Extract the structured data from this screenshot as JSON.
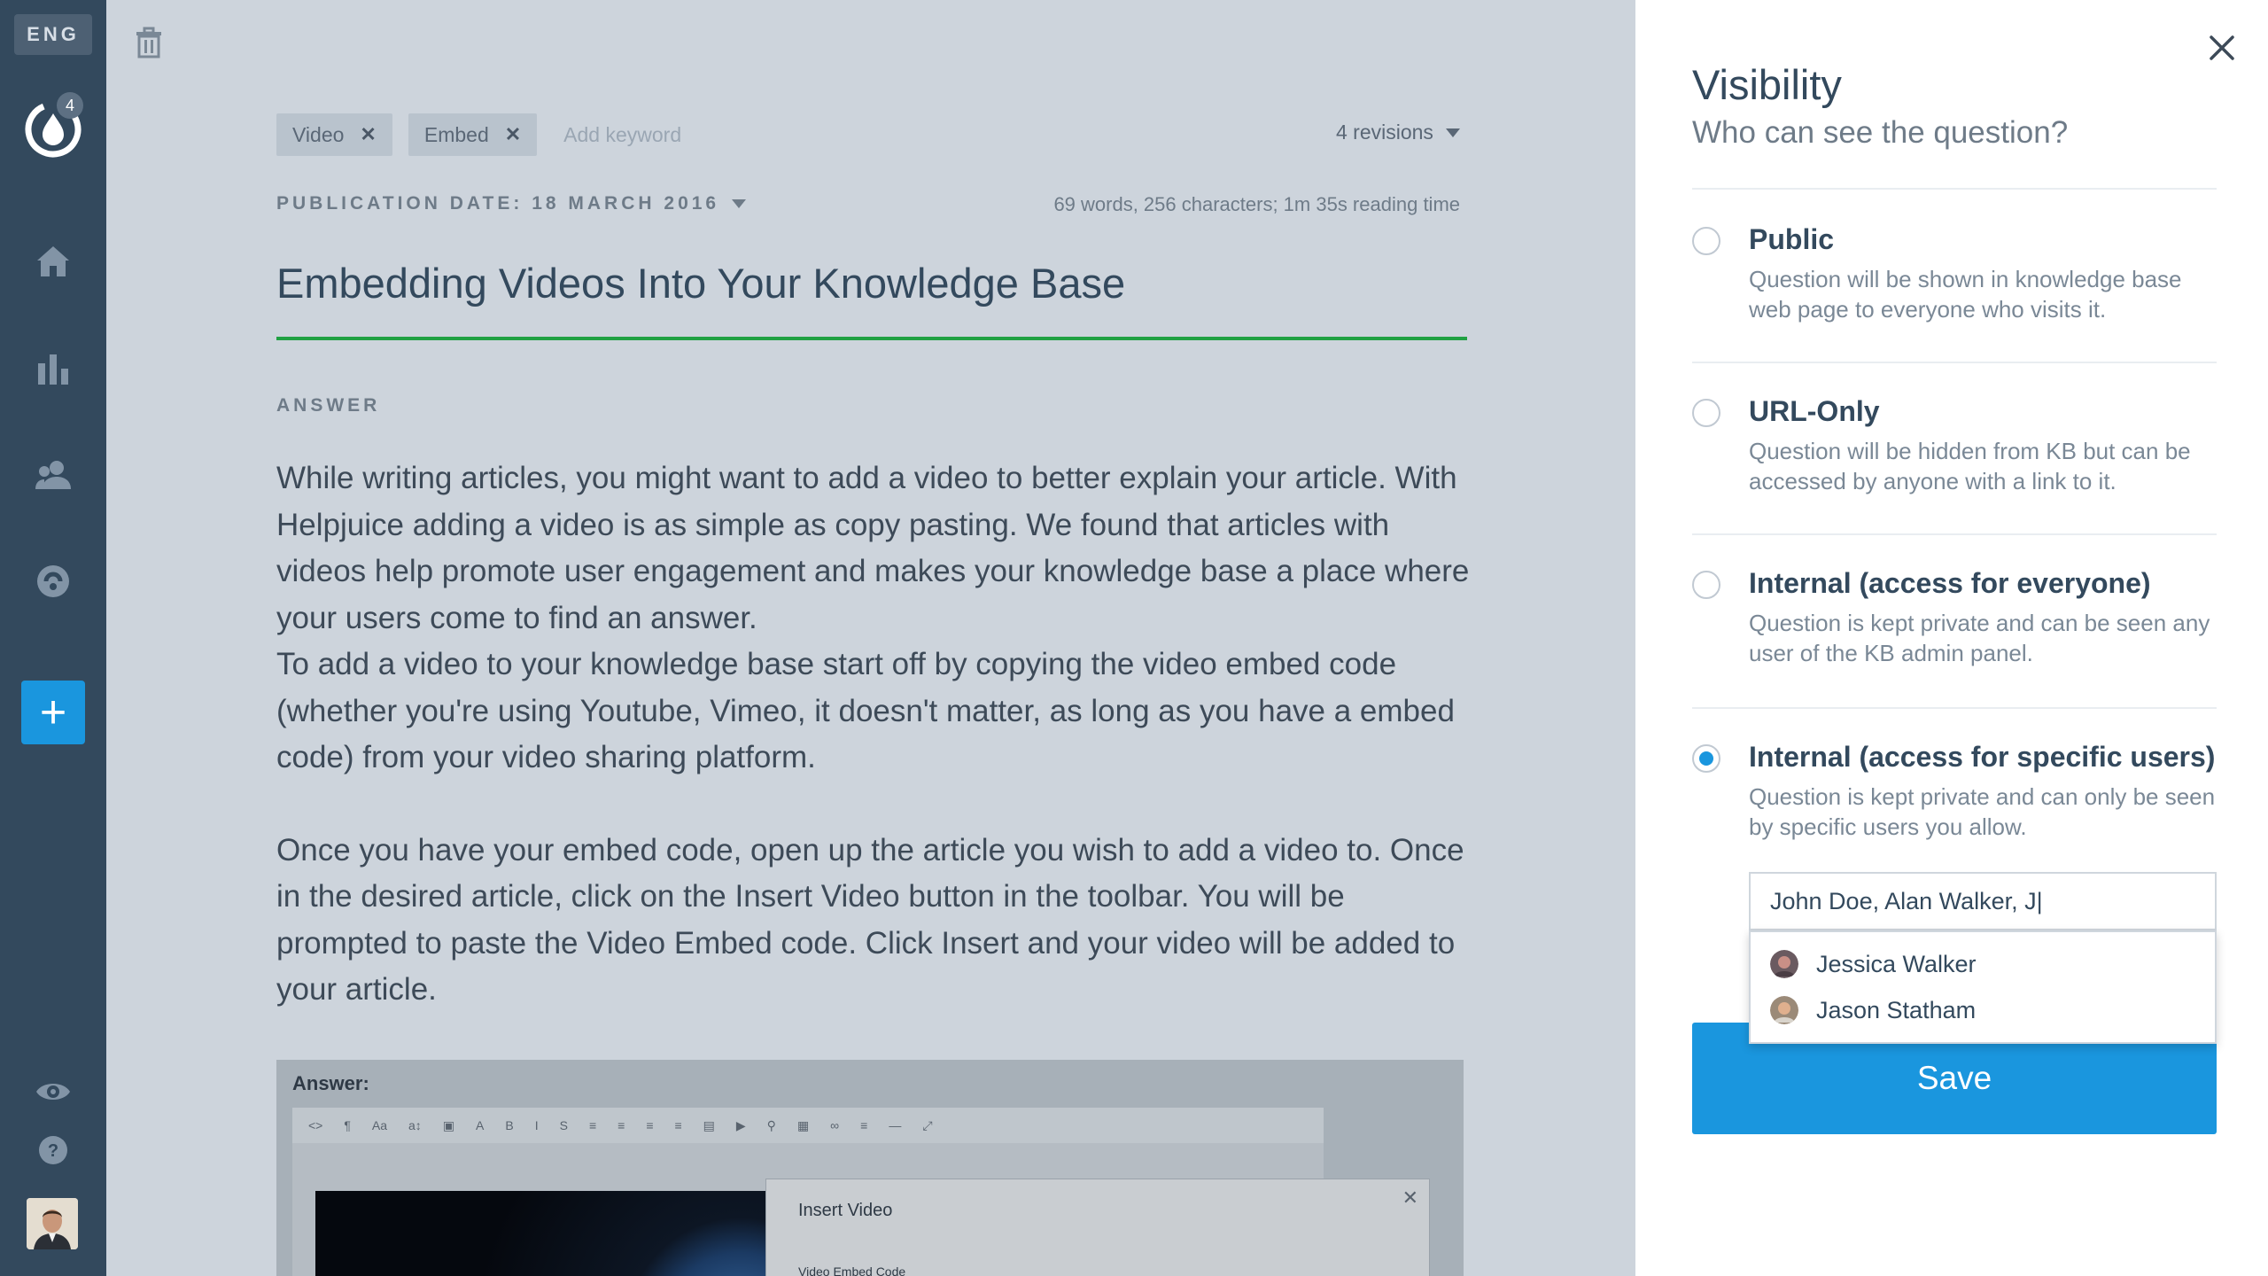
{
  "sidebar": {
    "language": "ENG",
    "logo_badge": "4",
    "icons": [
      "home-icon",
      "stats-icon",
      "users-icon",
      "integration-icon",
      "add-icon",
      "preview-icon",
      "help-icon"
    ],
    "add_label": "+"
  },
  "editor": {
    "tags": [
      {
        "label": "Video"
      },
      {
        "label": "Embed"
      }
    ],
    "tag_placeholder": "Add keyword",
    "revisions": "4 revisions",
    "publication_date": "PUBLICATION DATE: 18 MARCH 2016",
    "stats": "69 words, 256 characters; 1m 35s reading time",
    "title": "Embedding Videos Into Your Knowledge Base",
    "answer_label": "ANSWER",
    "paragraphs": [
      "While writing articles, you might want to add a video to better explain your article. With Helpjuice adding a video is as simple as copy pasting. We found that articles with videos help promote user engagement and makes your knowledge base a place where your users come to find an answer.",
      "To add a video to your knowledge base start off by copying the video embed code (whether you're using Youtube, Vimeo, it doesn't matter, as long as you have a embed code) from your video sharing platform.",
      "Once you have your embed code, open up the article you wish to add a video to. Once in the desired article, click on the Insert Video button in the toolbar. You will be prompted to paste the Video Embed code. Click Insert and your video will be added to your article."
    ],
    "screenshot": {
      "label": "Answer:",
      "modal_title": "Insert Video",
      "modal_field_label": "Video Embed Code"
    }
  },
  "panel": {
    "title": "Visibility",
    "subtitle": "Who can see the question?",
    "options": [
      {
        "label": "Public",
        "description": "Question will be shown in knowledge base web page to everyone who visits it.",
        "selected": false
      },
      {
        "label": "URL-Only",
        "description": "Question will be hidden from KB but can be accessed by anyone with a link to it.",
        "selected": false
      },
      {
        "label": "Internal (access for everyone)",
        "description": "Question is kept private and can be seen any user of the KB admin panel.",
        "selected": false
      },
      {
        "label": "Internal (access for specific users)",
        "description": "Question is kept private and can only be seen by specific users you allow.",
        "selected": true
      }
    ],
    "users_input_value": "John Doe, Alan Walker, J|",
    "suggestions": [
      {
        "name": "Jessica Walker"
      },
      {
        "name": "Jason Statham"
      }
    ],
    "save_label": "Save"
  },
  "colors": {
    "sidebar_bg": "#33495d",
    "accent_blue": "#1a96de",
    "title_underline": "#20a143",
    "overlay_bg": "#cdd4dc"
  }
}
